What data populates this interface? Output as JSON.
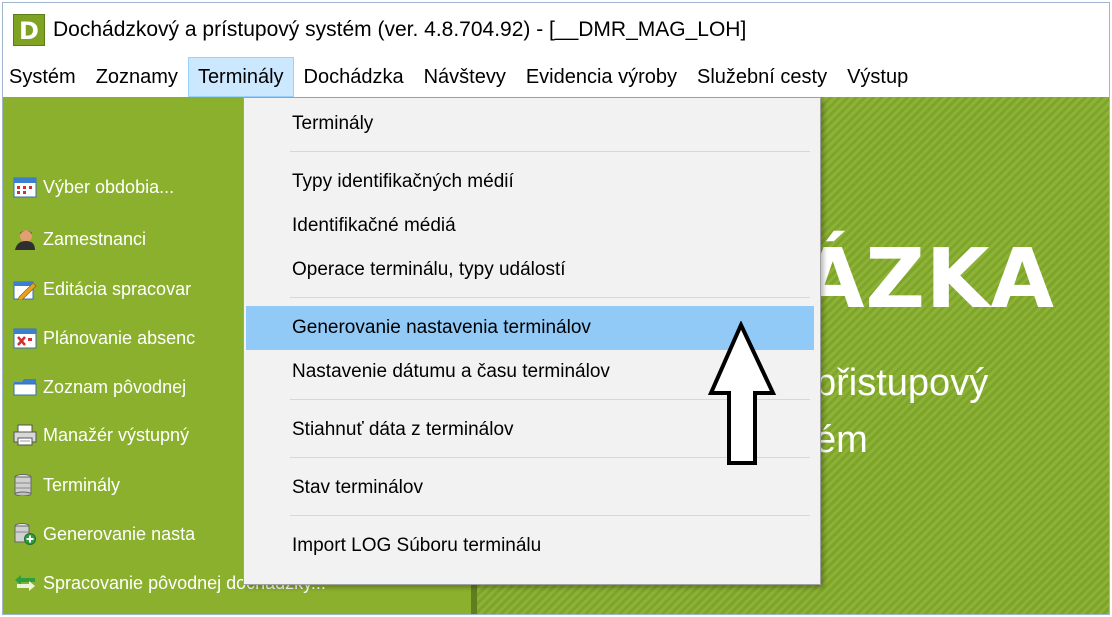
{
  "window": {
    "title": "Dochádzkový a prístupový systém (ver. 4.8.704.92) - [__DMR_MAG_LOH]",
    "logo_letter": "D"
  },
  "menubar": [
    {
      "label": "Systém"
    },
    {
      "label": "Zoznamy"
    },
    {
      "label": "Terminály"
    },
    {
      "label": "Dochádzka"
    },
    {
      "label": "Návštevy"
    },
    {
      "label": "Evidencia výroby"
    },
    {
      "label": "Služební cesty"
    },
    {
      "label": "Výstup"
    }
  ],
  "sidebar": {
    "items": [
      {
        "label": "Výber obdobia...",
        "icon": "calendar-icon"
      },
      {
        "label": "Zamestnanci",
        "icon": "person-icon"
      },
      {
        "label": "Editácia spracovar",
        "icon": "edit-icon"
      },
      {
        "label": "Plánovanie absenc",
        "icon": "calendar-x-icon"
      },
      {
        "label": "Zoznam pôvodnej",
        "icon": "folder-icon"
      },
      {
        "label": "Manažér výstupný",
        "icon": "printer-icon"
      },
      {
        "label": "Terminály",
        "icon": "server-icon"
      },
      {
        "label": "Generovanie nasta",
        "icon": "server-add-icon"
      },
      {
        "label": "Spracovanie pôvodnej dochádzky...",
        "icon": "arrow-left-icon"
      }
    ]
  },
  "dropdown": {
    "items": [
      {
        "label": "Terminály"
      },
      {
        "label": "Typy identifikačných médií"
      },
      {
        "label": "Identifikačné médiá"
      },
      {
        "label": "Operace terminálu, typy událostí"
      },
      {
        "label": "Generovanie nastavenia terminálov",
        "highlighted": true
      },
      {
        "label": "Nastavenie dátumu a času terminálov"
      },
      {
        "label": "Stiahnuť dáta z terminálov"
      },
      {
        "label": "Stav terminálov"
      },
      {
        "label": "Import LOG Súboru terminálu"
      }
    ]
  },
  "background_logo": {
    "big": "ÁZKA",
    "sub1": "přistupový",
    "sub2": "ém"
  },
  "colors": {
    "sidebar": "#8ab02e",
    "highlight": "#91c9f7",
    "menu_active": "#cce8ff"
  }
}
